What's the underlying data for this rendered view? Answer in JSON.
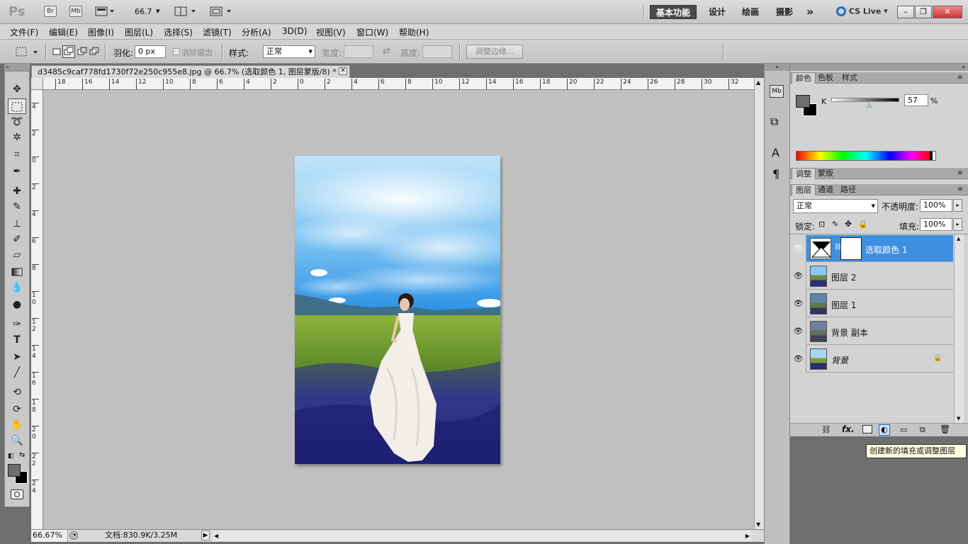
{
  "appbar": {
    "logo": "Ps",
    "btn_br": "Br",
    "btn_mb": "Mb",
    "zoom_value": "66.7",
    "workspaces": [
      "基本功能",
      "设计",
      "绘画",
      "摄影"
    ],
    "more": "»",
    "cslive": "CS Live",
    "window_min": "–",
    "window_restore": "❐",
    "window_close": "✕"
  },
  "menubar": {
    "items": [
      "文件(F)",
      "编辑(E)",
      "图像(I)",
      "图层(L)",
      "选择(S)",
      "滤镜(T)",
      "分析(A)",
      "3D(D)",
      "视图(V)",
      "窗口(W)",
      "帮助(H)"
    ]
  },
  "options": {
    "feather_label": "羽化:",
    "feather_value": "0 px",
    "antialias_label": "消除锯齿",
    "style_label": "样式:",
    "style_value": "正常",
    "width_label": "宽度:",
    "height_label": "高度:",
    "refine_edge": "调整边缘..."
  },
  "document": {
    "tab_title": "d3485c9caf778fd1730f72e250c955e8.jpg @ 66.7% (选取颜色 1, 图层蒙版/8) *",
    "close": "✕",
    "ruler_h": [
      "18",
      "16",
      "14",
      "12",
      "10",
      "8",
      "6",
      "4",
      "2",
      "0",
      "2",
      "4",
      "6",
      "8",
      "10",
      "12",
      "14",
      "16",
      "18",
      "20",
      "22",
      "24",
      "26",
      "28",
      "30",
      "32"
    ],
    "ruler_v": [
      "4",
      "2",
      "0",
      "2",
      "4",
      "6",
      "8",
      "1 0",
      "1 2",
      "1 4",
      "1 6",
      "1 8",
      "2 0",
      "2 2",
      "2 4"
    ]
  },
  "status": {
    "zoom": "66.67%",
    "doc_info": "文档:830.9K/3.25M"
  },
  "color_panel": {
    "tabs": [
      "颜色",
      "色板",
      "样式"
    ],
    "channel": "K",
    "value": "57",
    "unit": "%"
  },
  "adjust_panel": {
    "tabs": [
      "调整",
      "蒙版"
    ]
  },
  "layers_panel": {
    "tabs": [
      "图层",
      "通道",
      "路径"
    ],
    "blend_mode": "正常",
    "opacity_label": "不透明度:",
    "opacity_value": "100%",
    "lock_label": "锁定:",
    "fill_label": "填充:",
    "fill_value": "100%",
    "layers": [
      {
        "name": "选取颜色 1",
        "selected": true
      },
      {
        "name": "图层 2"
      },
      {
        "name": "图层 1"
      },
      {
        "name": "背景 副本"
      },
      {
        "name": "背景",
        "locked": true
      }
    ]
  },
  "tooltip": "创建新的填充或调整图层"
}
